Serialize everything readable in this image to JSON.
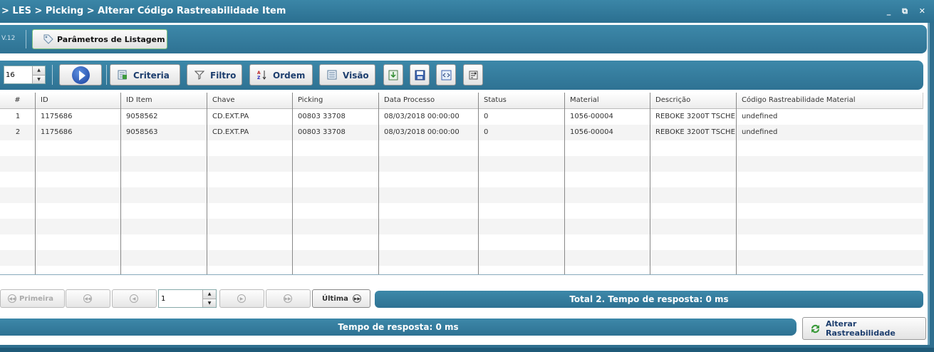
{
  "window": {
    "title": "> LES > Picking > Alterar Código Rastreabilidade Item",
    "controls": "_ ⧉ ✕"
  },
  "top_band": {
    "version": "V.12",
    "params_button": "Parâmetros de Listagem"
  },
  "toolbar": {
    "rows_value": "16",
    "criteria": "Criteria",
    "filtro": "Filtro",
    "ordem": "Ordem",
    "visao": "Visão"
  },
  "grid": {
    "columns": [
      "#",
      "ID",
      "ID Item",
      "Chave",
      "Picking",
      "Data Processo",
      "Status",
      "Material",
      "Descrição",
      "Código Rastreabilidade Material"
    ],
    "rows": [
      [
        "1",
        "1175686",
        "9058562",
        "CD.EXT.PA",
        "00803 33708",
        "08/03/2018 00:00:00",
        "0",
        "1056-00004",
        "REBOKE 3200T TSCHE",
        "undefined"
      ],
      [
        "2",
        "1175686",
        "9058563",
        "CD.EXT.PA",
        "00803 33708",
        "08/03/2018 00:00:00",
        "0",
        "1056-00004",
        "REBOKE 3200T TSCHE",
        "undefined"
      ]
    ]
  },
  "pager": {
    "first": "Primeira",
    "last": "Última",
    "page_value": "1",
    "total_text": "Total 2. Tempo de resposta: 0 ms"
  },
  "bottom": {
    "response_text": "Tempo de resposta: 0 ms",
    "alter_button": "Alterar Rastreabilidade"
  },
  "colors": {
    "band": "#2e7293",
    "title_bg": "#2b6f90"
  }
}
